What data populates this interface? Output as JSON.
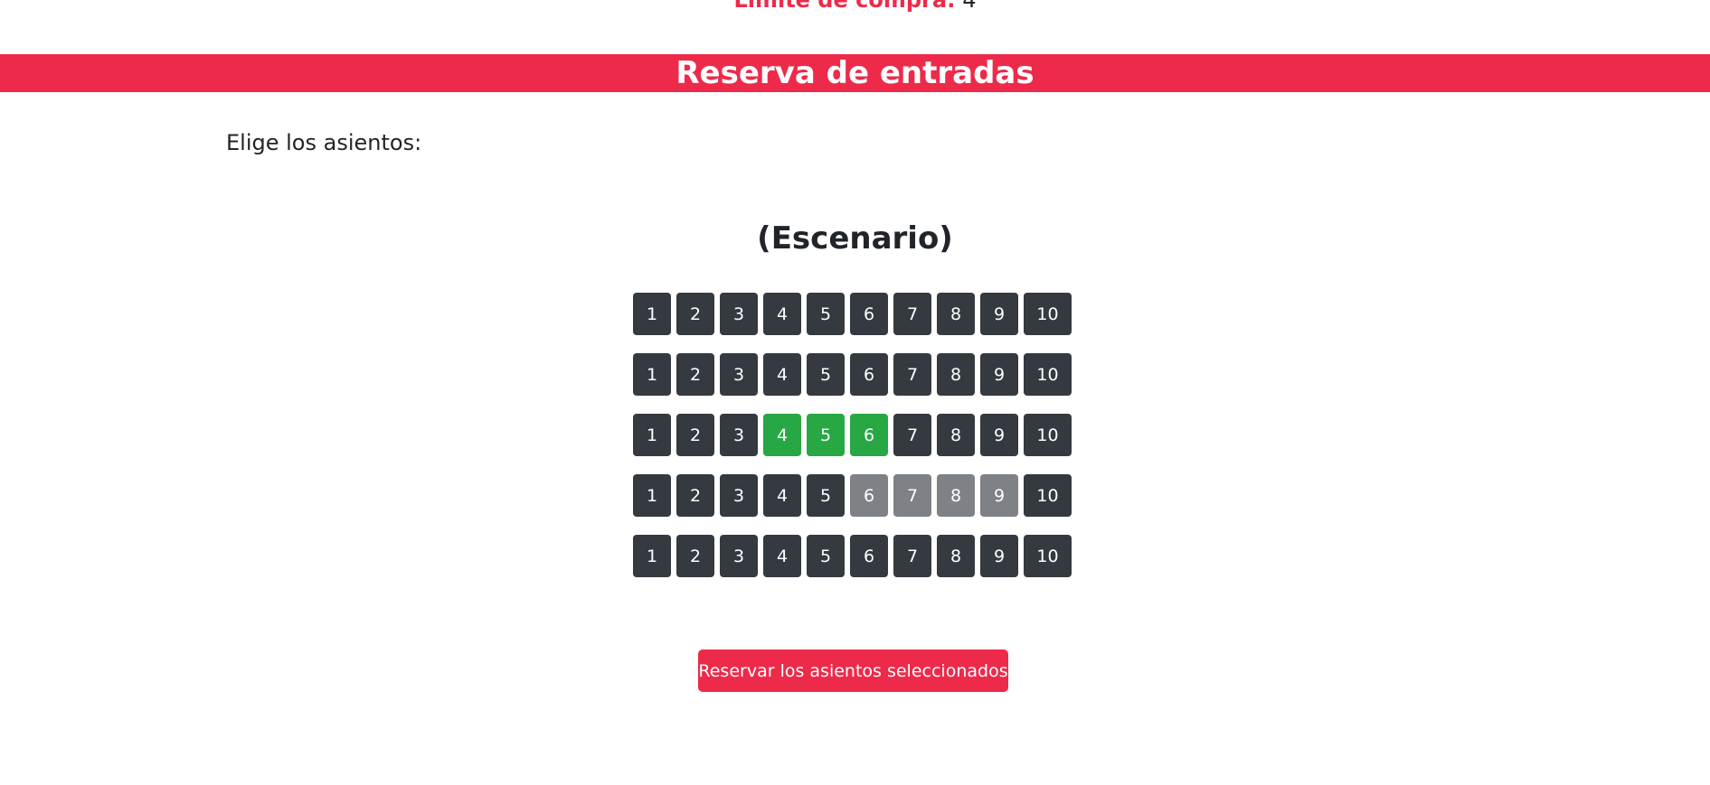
{
  "header": {
    "limit_label": "Límite de compra:",
    "limit_value": "4",
    "title": "Reserva de entradas"
  },
  "main": {
    "instruction": "Elige los asientos:",
    "stage_label": "(Escenario)",
    "reserve_button_label": "Reservar los asientos seleccionados"
  },
  "seat_map": {
    "rows": [
      [
        {
          "number": "1",
          "state": "available"
        },
        {
          "number": "2",
          "state": "available"
        },
        {
          "number": "3",
          "state": "available"
        },
        {
          "number": "4",
          "state": "available"
        },
        {
          "number": "5",
          "state": "available"
        },
        {
          "number": "6",
          "state": "available"
        },
        {
          "number": "7",
          "state": "available"
        },
        {
          "number": "8",
          "state": "available"
        },
        {
          "number": "9",
          "state": "available"
        },
        {
          "number": "10",
          "state": "available"
        }
      ],
      [
        {
          "number": "1",
          "state": "available"
        },
        {
          "number": "2",
          "state": "available"
        },
        {
          "number": "3",
          "state": "available"
        },
        {
          "number": "4",
          "state": "available"
        },
        {
          "number": "5",
          "state": "available"
        },
        {
          "number": "6",
          "state": "available"
        },
        {
          "number": "7",
          "state": "available"
        },
        {
          "number": "8",
          "state": "available"
        },
        {
          "number": "9",
          "state": "available"
        },
        {
          "number": "10",
          "state": "available"
        }
      ],
      [
        {
          "number": "1",
          "state": "available"
        },
        {
          "number": "2",
          "state": "available"
        },
        {
          "number": "3",
          "state": "available"
        },
        {
          "number": "4",
          "state": "selected"
        },
        {
          "number": "5",
          "state": "selected"
        },
        {
          "number": "6",
          "state": "selected"
        },
        {
          "number": "7",
          "state": "available"
        },
        {
          "number": "8",
          "state": "available"
        },
        {
          "number": "9",
          "state": "available"
        },
        {
          "number": "10",
          "state": "available"
        }
      ],
      [
        {
          "number": "1",
          "state": "available"
        },
        {
          "number": "2",
          "state": "available"
        },
        {
          "number": "3",
          "state": "available"
        },
        {
          "number": "4",
          "state": "available"
        },
        {
          "number": "5",
          "state": "available"
        },
        {
          "number": "6",
          "state": "occupied"
        },
        {
          "number": "7",
          "state": "occupied"
        },
        {
          "number": "8",
          "state": "occupied"
        },
        {
          "number": "9",
          "state": "occupied"
        },
        {
          "number": "10",
          "state": "available"
        }
      ],
      [
        {
          "number": "1",
          "state": "available"
        },
        {
          "number": "2",
          "state": "available"
        },
        {
          "number": "3",
          "state": "available"
        },
        {
          "number": "4",
          "state": "available"
        },
        {
          "number": "5",
          "state": "available"
        },
        {
          "number": "6",
          "state": "available"
        },
        {
          "number": "7",
          "state": "available"
        },
        {
          "number": "8",
          "state": "available"
        },
        {
          "number": "9",
          "state": "available"
        },
        {
          "number": "10",
          "state": "available"
        }
      ]
    ]
  },
  "colors": {
    "accent": "#ee2a4a",
    "seat_available": "#343a40",
    "seat_selected": "#28a745",
    "seat_occupied": "#7e8185"
  }
}
